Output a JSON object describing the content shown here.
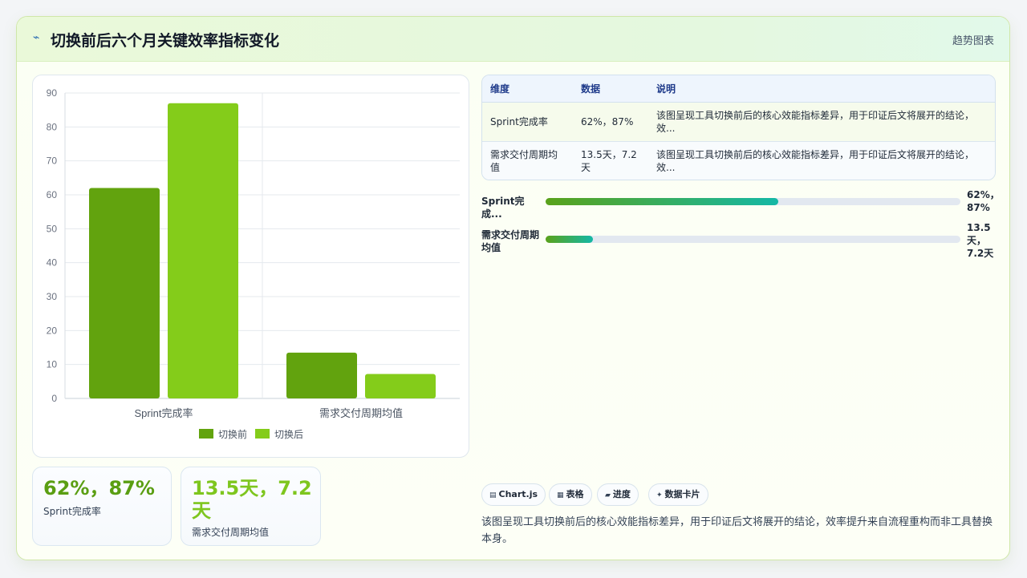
{
  "header": {
    "title": "切换前后六个月关键效率指标变化",
    "tag": "趋势图表",
    "icon": "line-chart-icon"
  },
  "colors": {
    "before": "#62a30e",
    "after": "#84cc1a",
    "accent": "#14b8a6"
  },
  "chart_data": {
    "type": "bar",
    "categories": [
      "Sprint完成率",
      "需求交付周期均值"
    ],
    "series": [
      {
        "name": "切换前",
        "values": [
          62,
          13.5
        ]
      },
      {
        "name": "切换后",
        "values": [
          87,
          7.2
        ]
      }
    ],
    "ylim": [
      0,
      90
    ],
    "yticks": [
      "0",
      "10",
      "20",
      "30",
      "40",
      "50",
      "60",
      "70",
      "80",
      "90"
    ],
    "grid": true,
    "legend": "bottom"
  },
  "kpis": [
    {
      "value": "62%，87%",
      "label": "Sprint完成率",
      "color": "#5a9e12"
    },
    {
      "value": "13.5天，7.2天",
      "label": "需求交付周期均值",
      "color": "#7ec61e"
    }
  ],
  "table": {
    "headers": [
      "维度",
      "数据",
      "说明"
    ],
    "rows": [
      {
        "dim": "Sprint完成率",
        "data": "62%，87%",
        "note": "该图呈现工具切换前后的核心效能指标差异，用于印证后文将展开的结论，效..."
      },
      {
        "dim": "需求交付周期均值",
        "data": "13.5天，7.2天",
        "note": "该图呈现工具切换前后的核心效能指标差异，用于印证后文将展开的结论，效..."
      }
    ]
  },
  "progress": [
    {
      "label": "Sprint完成...",
      "value": "62%，87%",
      "fraction": 0.56
    },
    {
      "label": "需求交付周期均值",
      "value": "13.5天，7.2天",
      "fraction": 0.115
    }
  ],
  "chips": [
    {
      "icon": "chart-icon",
      "glyph": "▤",
      "label": "Chart.js"
    },
    {
      "icon": "table-icon",
      "glyph": "▦",
      "label": "表格"
    },
    {
      "icon": "progress-icon",
      "glyph": "▰",
      "label": "进度"
    },
    {
      "icon": "card-icon",
      "glyph": "✦",
      "label": "数据卡片"
    }
  ],
  "description": "该图呈现工具切换前后的核心效能指标差异，用于印证后文将展开的结论，效率提升来自流程重构而非工具替换本身。"
}
